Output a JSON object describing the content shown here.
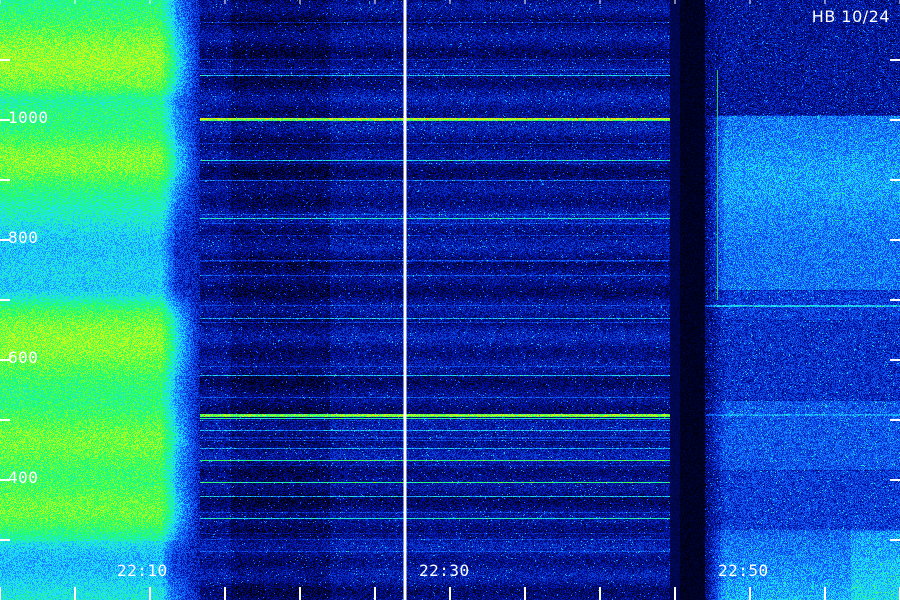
{
  "station": "HB 10/24",
  "frequency_labels": {
    "f1000": "1000",
    "f800": "800",
    "f600": "600",
    "f400": "400"
  },
  "time_labels": {
    "t2210": "22:10",
    "t2230": "22:30",
    "t2250": "22:50"
  },
  "colormap": [
    "#000010",
    "#0010a0",
    "#1060ff",
    "#20e0ff",
    "#20ff60",
    "#c0ff20",
    "#ffd000",
    "#ff4000"
  ],
  "label_color": "#ffffff"
}
